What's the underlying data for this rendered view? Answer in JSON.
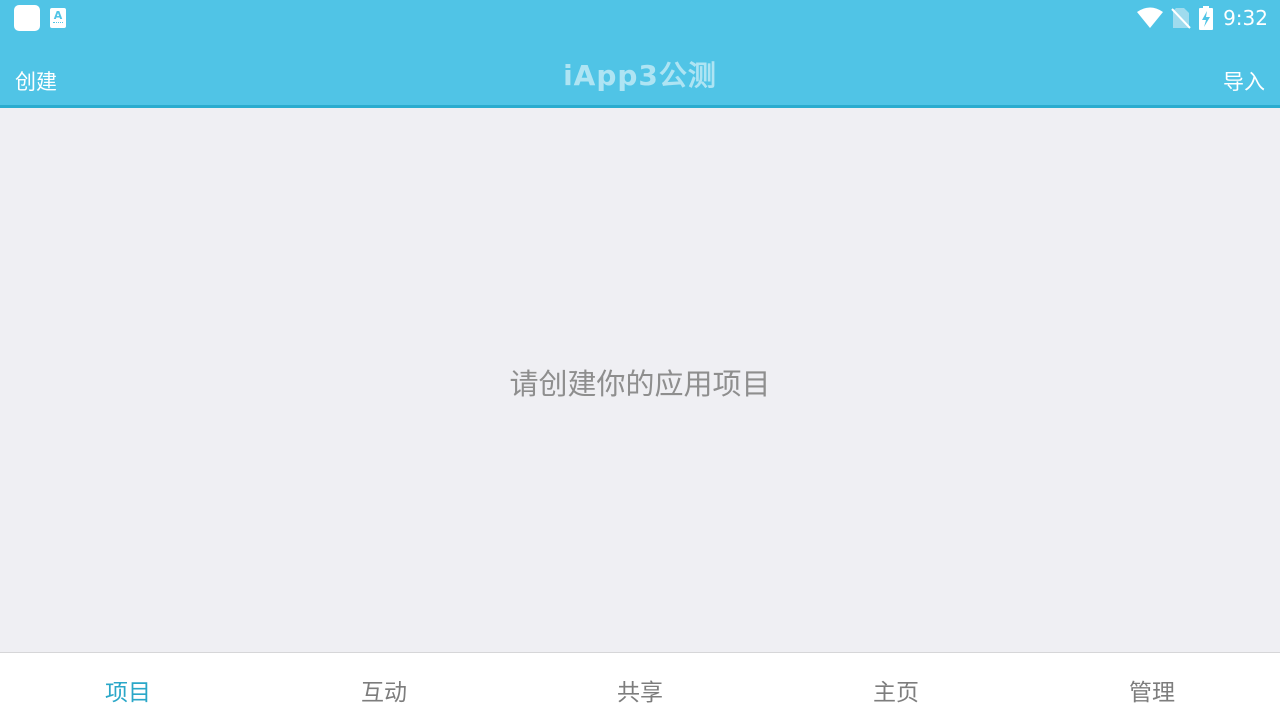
{
  "status_bar": {
    "time": "9:32",
    "notification_icons": [
      "app-notification-icon",
      "translate-a-icon"
    ],
    "system_icons": [
      "wifi-icon",
      "no-sim-icon",
      "battery-charging-icon"
    ]
  },
  "app_bar": {
    "title": "iApp3公测",
    "left_action": "创建",
    "right_action": "导入"
  },
  "main": {
    "empty_message": "请创建你的应用项目"
  },
  "tabs": [
    {
      "label": "项目",
      "active": true
    },
    {
      "label": "互动",
      "active": false
    },
    {
      "label": "共享",
      "active": false
    },
    {
      "label": "主页",
      "active": false
    },
    {
      "label": "管理",
      "active": false
    }
  ],
  "colors": {
    "accent": "#50c4e6",
    "active_tab": "#2aa7c8",
    "background": "#efeff3"
  }
}
